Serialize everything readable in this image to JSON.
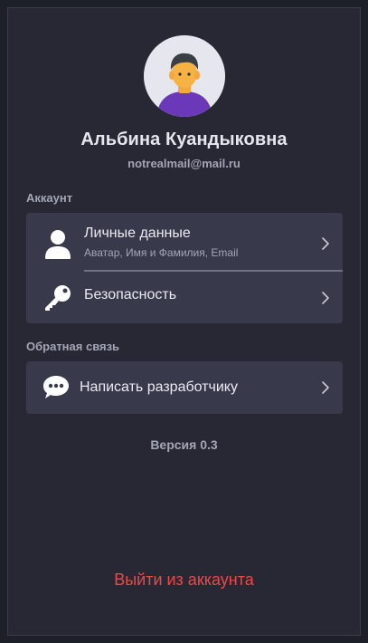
{
  "profile": {
    "name": "Альбина Куандыковна",
    "email": "notrealmail@mail.ru",
    "avatar_icon": "user-avatar-icon"
  },
  "account_section": {
    "title": "Аккаунт",
    "items": [
      {
        "label": "Личные данные",
        "sublabel": "Аватар, Имя и Фамилия, Email",
        "icon": "person-icon"
      },
      {
        "label": "Безопасность",
        "icon": "key-icon"
      }
    ]
  },
  "feedback_section": {
    "title": "Обратная связь",
    "items": [
      {
        "label": "Написать разработчику",
        "icon": "chat-bubble-icon"
      }
    ]
  },
  "version_label": "Версия 0.3",
  "logout_label": "Выйти из аккаунта",
  "colors": {
    "background": "#272834",
    "card": "#383a4c",
    "accent_avatar": "#6a38b8",
    "logout": "#e84a4a"
  }
}
